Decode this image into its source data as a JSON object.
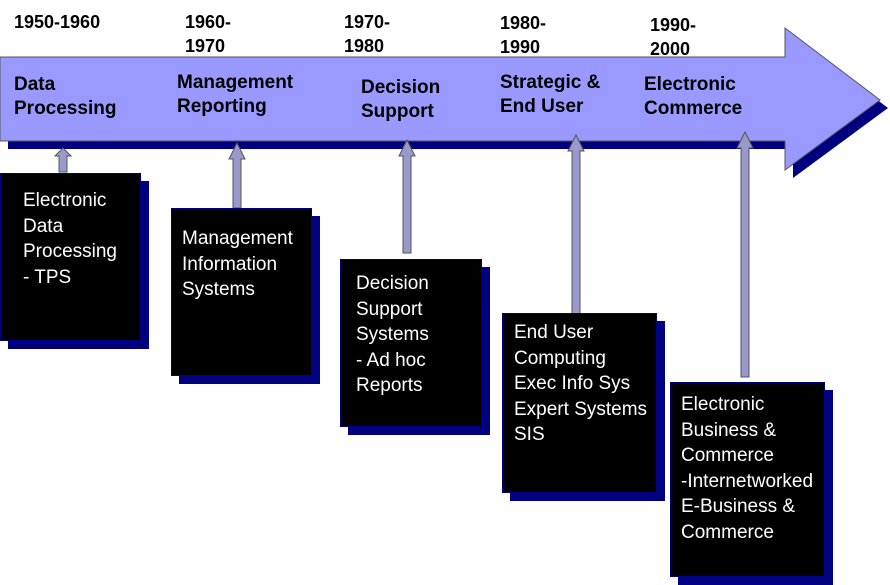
{
  "colors": {
    "arrow_fill": "#9999ff",
    "shadow": "#000080",
    "connector_fill": "#9999cc",
    "box_fill": "#000000",
    "box_text": "#ffffff"
  },
  "stages": [
    {
      "period_lines": [
        "1950-1960"
      ],
      "era_lines": [
        "Data",
        "Processing"
      ],
      "system_lines": [
        "Electronic",
        "Data",
        "Processing",
        "- TPS"
      ]
    },
    {
      "period_lines": [
        "1960-",
        "1970"
      ],
      "era_lines": [
        "Management",
        "Reporting"
      ],
      "system_lines": [
        "Management",
        "Information",
        "Systems"
      ]
    },
    {
      "period_lines": [
        "1970-",
        "1980"
      ],
      "era_lines": [
        "Decision",
        "Support"
      ],
      "system_lines": [
        "Decision",
        "Support",
        "Systems",
        "- Ad hoc",
        "Reports"
      ]
    },
    {
      "period_lines": [
        "1980-",
        "1990"
      ],
      "era_lines": [
        "Strategic &",
        "End User"
      ],
      "system_lines": [
        "End User",
        "Computing",
        "Exec Info Sys",
        "Expert Systems",
        "SIS"
      ]
    },
    {
      "period_lines": [
        "1990-",
        "2000"
      ],
      "era_lines": [
        "Electronic",
        "Commerce"
      ],
      "system_lines": [
        "Electronic",
        "Business &",
        "Commerce",
        "-Internetworked",
        "E-Business &",
        "Commerce"
      ]
    }
  ]
}
